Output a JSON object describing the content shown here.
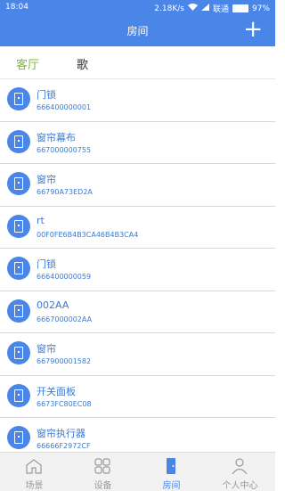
{
  "statusbar": {
    "time": "18:04",
    "speed": "2.18K/s",
    "carrier": "联通",
    "battery_text": "97%",
    "battery_level": 0.97
  },
  "header": {
    "title": "房间",
    "add_icon": "plus-icon"
  },
  "room_tabs": [
    {
      "label": "客厅"
    },
    {
      "label": "歌"
    }
  ],
  "devices": [
    {
      "name": "门锁",
      "code": "666400000001"
    },
    {
      "name": "窗帘幕布",
      "code": "667000000755"
    },
    {
      "name": "窗帘",
      "code": "66790A73ED2A"
    },
    {
      "name": "rt",
      "code": "00F0FE6B4B3CA46B4B3CA4"
    },
    {
      "name": "门锁",
      "code": "666400000059"
    },
    {
      "name": "002AA",
      "code": "6667000002AA"
    },
    {
      "name": "窗帘",
      "code": "667900001582"
    },
    {
      "name": "开关面板",
      "code": "6673FC80EC08"
    },
    {
      "name": "窗帘执行器",
      "code": "66666F2972CF"
    }
  ],
  "bottom_nav": [
    {
      "label": "场景",
      "icon": "home-icon"
    },
    {
      "label": "设备",
      "icon": "grid-icon"
    },
    {
      "label": "房间",
      "icon": "door-icon"
    },
    {
      "label": "个人中心",
      "icon": "user-icon"
    }
  ],
  "colors": {
    "primary": "#4a86e8",
    "tab_active": "#7dbb3e",
    "text_blue": "#3a7bd5"
  }
}
